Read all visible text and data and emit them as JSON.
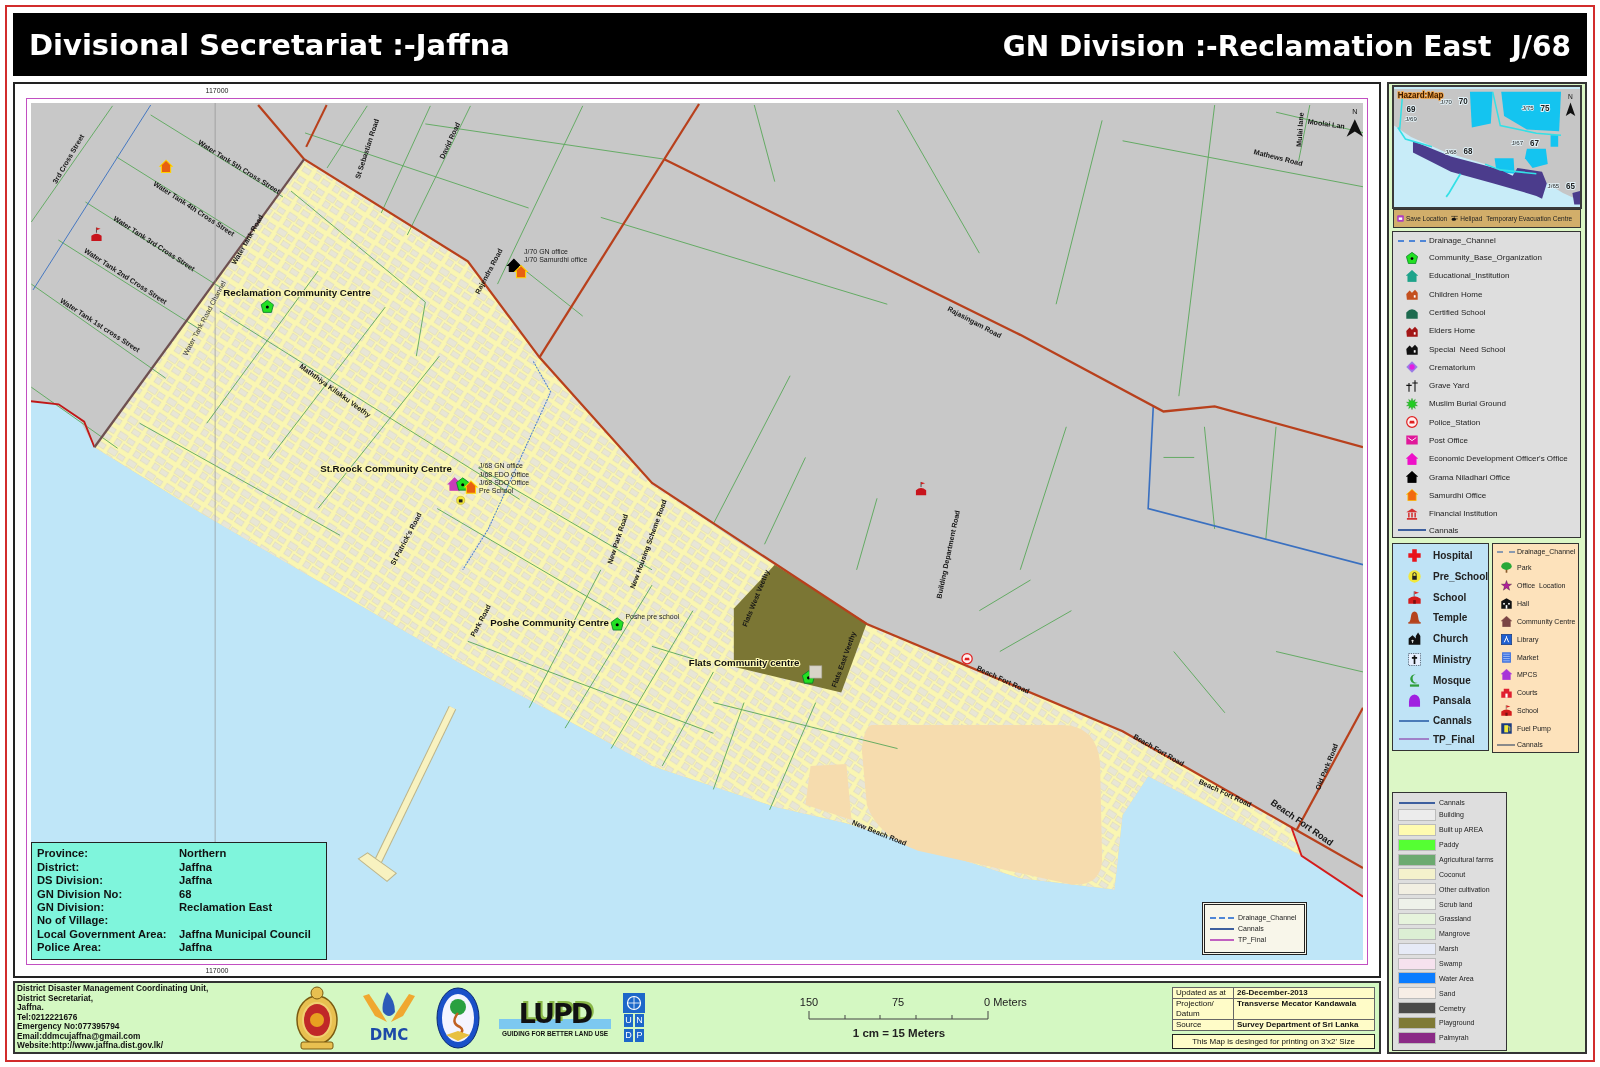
{
  "header": {
    "title": "Divisional Secretariat :-Jaffna",
    "division": "GN Division :-Reclamation East",
    "code": "J/68"
  },
  "map": {
    "grid_labels": [
      "117000",
      "117000"
    ],
    "road_labels": [
      "3rd Cross Street",
      "Water Tank 5th Cross Street",
      "Water Tank 4th Cross Street",
      "Water Tank 3rd Cross Street",
      "Water Tank 2nd Cross Street",
      "Water Tank 1st cross Street",
      "Water tank Road",
      "St Sebastian Road",
      "David Road",
      "Rajendra Road",
      "Maththiya Kilakku Veethy",
      "St Patrick's Road",
      "Park Road",
      "New Park Road",
      "New Housing Scheme Road",
      "Flats West Veethy",
      "Flats East Veethy",
      "Building Department Road",
      "Rajasingam Road",
      "Mathews Road",
      "Moolai Lan",
      "Beach Fort Road",
      "Beach Fort Road",
      "Beach Fort Road",
      "Beach Fort Road",
      "Old Park Road",
      "New Beach Road",
      "Mulai lane"
    ],
    "channel_labels": [
      "Water Tank Road Channel"
    ],
    "place_labels": [
      "Reclamation Community Centre",
      "St.Roock Community Centre",
      "Poshe Community Centre",
      "Flats Community centre"
    ],
    "office_labels": [
      "J/70 GN office",
      "J/70 Samurdhi office",
      "J/68 GN office",
      "J/68 EDO Office",
      "J/68 SDO Office",
      "Pre School",
      "Poshe pre school"
    ],
    "north": "N",
    "legend": [
      {
        "label": "Drainage_Channel",
        "kind": "dashed",
        "color": "#4f86d6"
      },
      {
        "label": "Cannals",
        "kind": "line",
        "color": "#3d5f9e"
      },
      {
        "label": "TP_Final",
        "kind": "line",
        "color": "#c060c0"
      }
    ]
  },
  "info_box": [
    {
      "label": "Province:",
      "value": "Northern"
    },
    {
      "label": "District:",
      "value": "Jaffna"
    },
    {
      "label": "DS Division:",
      "value": "Jaffna"
    },
    {
      "label": "GN Division No:",
      "value": "68"
    },
    {
      "label": "GN Division:",
      "value": "Reclamation East"
    },
    {
      "label": "No of Village:"
    },
    {
      "label": "Local Government Area:",
      "value": "Jaffna Municipal Council"
    },
    {
      "label": "Police Area:",
      "value": "Jaffna"
    }
  ],
  "hazard_map": {
    "title": "Hazard:Map",
    "north": "N",
    "zones": [
      {
        "number": "69",
        "code": "J/69"
      },
      {
        "number": "70",
        "code": "J/70"
      },
      {
        "number": "75",
        "code": "J/75"
      },
      {
        "number": "68",
        "code": "J/68"
      },
      {
        "number": "67",
        "code": "J/67"
      },
      {
        "number": "65",
        "code": "J/65"
      }
    ]
  },
  "evacuation_bar": [
    "Save Location",
    "Helipad",
    "Temporary Evacuation Centre"
  ],
  "legend_facilities": [
    {
      "label": "Drainage_Channel",
      "kind": "dashed",
      "color": "#4f86d6"
    },
    {
      "label": "Community_Base_Organization",
      "kind": "symbol"
    },
    {
      "label": "Educational_Institution",
      "kind": "symbol"
    },
    {
      "label": "Children Home",
      "kind": "symbol"
    },
    {
      "label": "Certified School",
      "kind": "symbol"
    },
    {
      "label": "Elders Home",
      "kind": "symbol"
    },
    {
      "label": "Special  Need School",
      "kind": "symbol"
    },
    {
      "label": "Crematorium",
      "kind": "symbol"
    },
    {
      "label": "Grave Yard",
      "kind": "symbol"
    },
    {
      "label": "Muslim Burial Ground",
      "kind": "symbol"
    },
    {
      "label": "Police_Station",
      "kind": "symbol"
    },
    {
      "label": "Post Office",
      "kind": "symbol"
    },
    {
      "label": "Economic Development Officer's Office",
      "kind": "symbol"
    },
    {
      "label": "Grama Niladhari Office",
      "kind": "symbol"
    },
    {
      "label": "Samurdhi Office",
      "kind": "symbol"
    },
    {
      "label": "Financial Institution",
      "kind": "symbol"
    },
    {
      "label": "Cannals",
      "kind": "line",
      "color": "#3d5f9e"
    }
  ],
  "legend_services": [
    {
      "label": "Hospital",
      "kind": "symbol"
    },
    {
      "label": "Pre_School",
      "kind": "symbol"
    },
    {
      "label": "School",
      "kind": "symbol"
    },
    {
      "label": "Temple",
      "kind": "symbol"
    },
    {
      "label": "Church",
      "kind": "symbol"
    },
    {
      "label": "Ministry",
      "kind": "symbol"
    },
    {
      "label": "Mosque",
      "kind": "symbol"
    },
    {
      "label": "Pansala",
      "kind": "symbol"
    },
    {
      "label": "Cannals",
      "kind": "line",
      "color": "#4a7ab8"
    },
    {
      "label": "TP_Final",
      "kind": "line",
      "color": "#a080c8"
    }
  ],
  "legend_amenities": [
    {
      "label": "Drainage_Channel",
      "kind": "dashed",
      "color": "#8a9ab0"
    },
    {
      "label": "Park",
      "kind": "symbol"
    },
    {
      "label": "Office  Location",
      "kind": "symbol"
    },
    {
      "label": "Hall",
      "kind": "symbol"
    },
    {
      "label": "Community Centre",
      "kind": "symbol"
    },
    {
      "label": "Library",
      "kind": "symbol"
    },
    {
      "label": "Market",
      "kind": "symbol"
    },
    {
      "label": "MPCS",
      "kind": "symbol"
    },
    {
      "label": "Courts",
      "kind": "symbol"
    },
    {
      "label": "School",
      "kind": "symbol"
    },
    {
      "label": "Fuel Pump",
      "kind": "symbol"
    },
    {
      "label": "Cannals",
      "kind": "line",
      "color": "#8a8a8a"
    }
  ],
  "legend_landuse": [
    {
      "label": "Cannals",
      "kind": "line",
      "color": "#3d5f9e"
    },
    {
      "label": "Building",
      "kind": "fill",
      "color": "#ececec"
    },
    {
      "label": "Built up AREA",
      "kind": "fill",
      "color": "#fffbb0"
    },
    {
      "label": "Paddy",
      "kind": "fill",
      "color": "#55ff33"
    },
    {
      "label": "Agricultural farms",
      "kind": "fill",
      "color": "#6caa70"
    },
    {
      "label": "Coconut",
      "kind": "fill",
      "color": "#f4f2cc"
    },
    {
      "label": "Other cultivation",
      "kind": "fill",
      "color": "#f2efe2"
    },
    {
      "label": "Scrub land",
      "kind": "fill",
      "color": "#eef2ea"
    },
    {
      "label": "Grassland",
      "kind": "fill",
      "color": "#e6f3dc"
    },
    {
      "label": "Mangrove",
      "kind": "fill",
      "color": "#dcefd4"
    },
    {
      "label": "Marsh",
      "kind": "fill",
      "color": "#e6eaf6"
    },
    {
      "label": "Swamp",
      "kind": "fill",
      "color": "#f6e2ee"
    },
    {
      "label": "Water Area",
      "kind": "fill",
      "color": "#0a7cff"
    },
    {
      "label": "Sand",
      "kind": "fill",
      "color": "#f7eee6"
    },
    {
      "label": "Cemetry",
      "kind": "fill",
      "color": "#4a4a4a"
    },
    {
      "label": "Playground",
      "kind": "fill",
      "color": "#7f7a35"
    },
    {
      "label": "Palmyrah",
      "kind": "fill",
      "color": "#8b2a86"
    }
  ],
  "footer": {
    "contact": [
      "District Disaster Management Coordinating Unit,",
      "District Secretariat,",
      "Jaffna.",
      "Tel:0212221676",
      "Emergency No:077395794",
      "Email:ddmcujaffna@gmail.com",
      "Website:http://www.jaffna.dist.gov.lk/"
    ],
    "logos": {
      "dmc": "DMC",
      "lupd": "LUPD",
      "lupd_tagline": "GUIDING FOR BETTER LAND USE",
      "undp": [
        "U",
        "N",
        "D",
        "P"
      ]
    },
    "scale": {
      "ticks": [
        "150",
        "75",
        "0 Meters"
      ],
      "ratio": "1 cm = 15 Meters"
    },
    "metadata": [
      {
        "label": "Updated as at",
        "value": "26-December-2013"
      },
      {
        "label": "Projection/ Datum",
        "value": "Transverse Mecator Kandawala"
      },
      {
        "label": "Source",
        "value": "Survey Department of Sri Lanka"
      }
    ],
    "note": "This Map is desinged for printing on 3'x2' Size"
  }
}
